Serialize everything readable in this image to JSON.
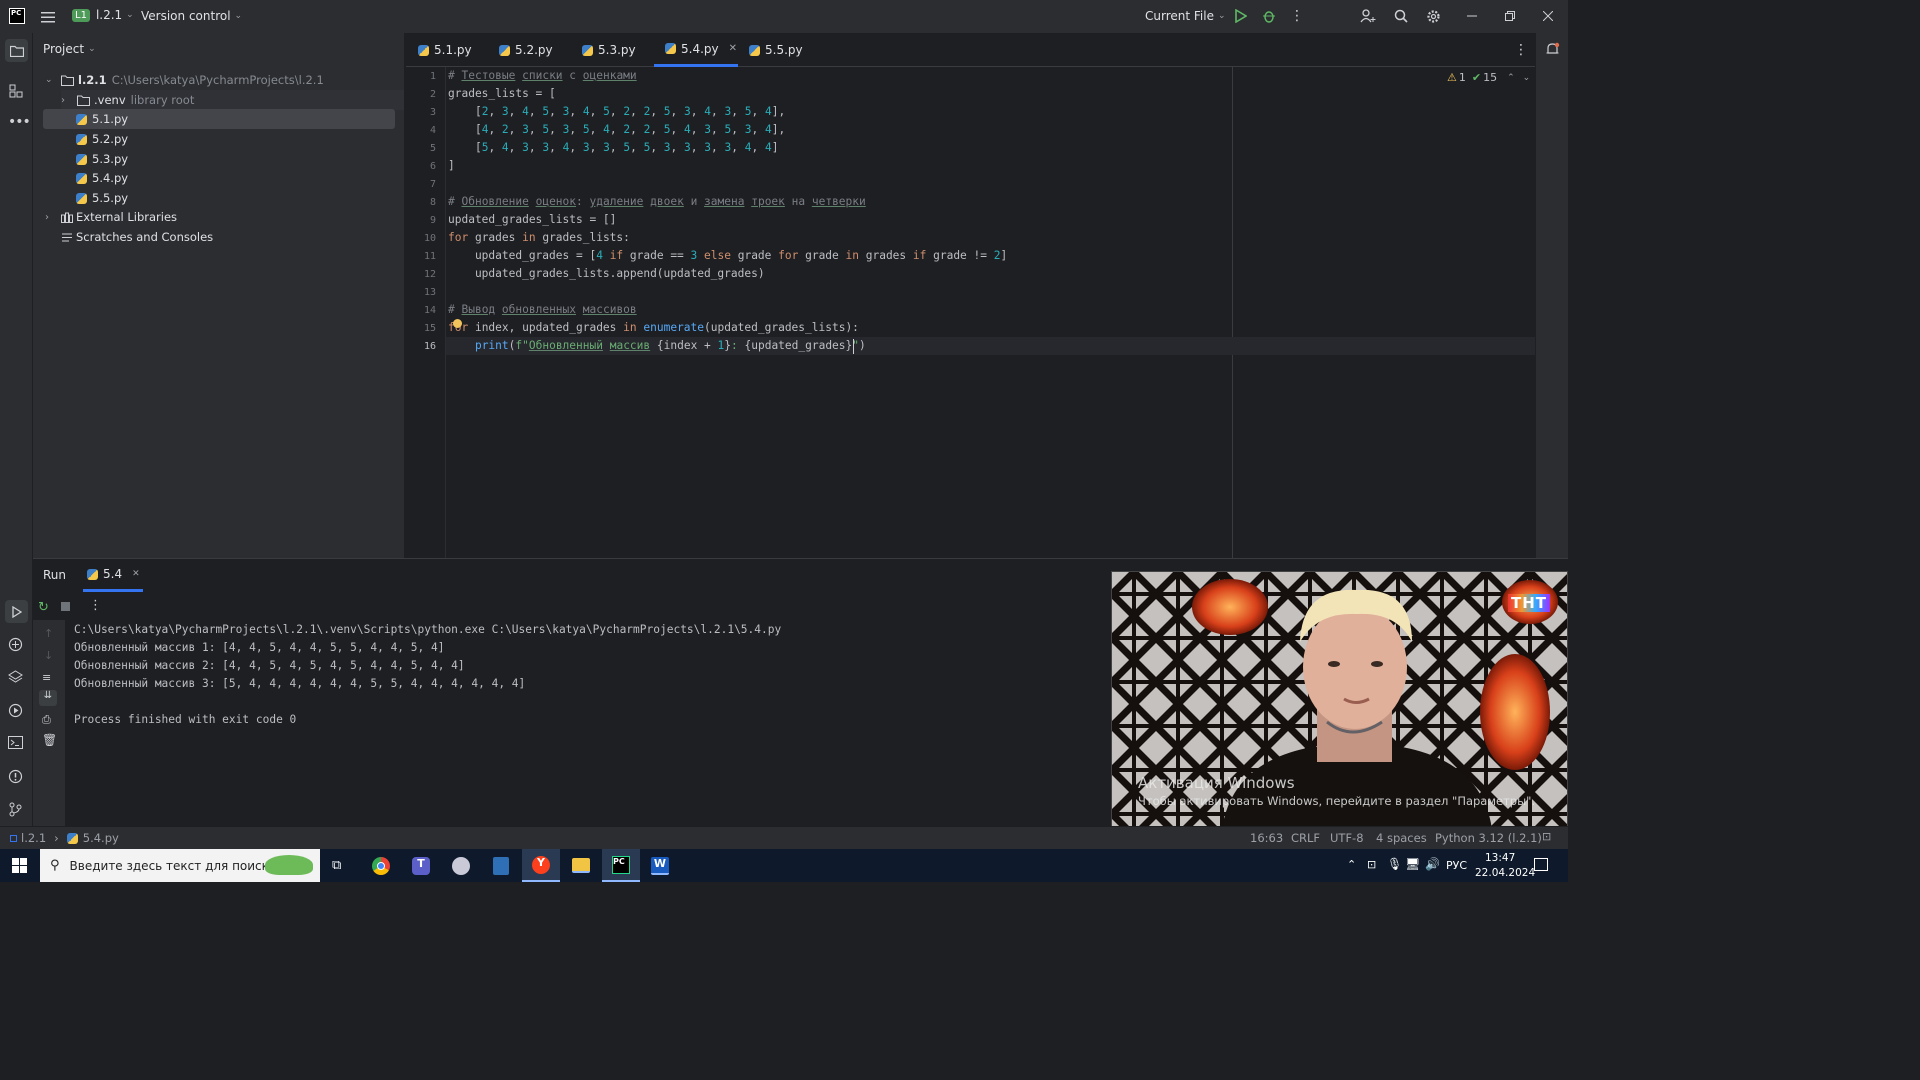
{
  "titlebar": {
    "project_badge": "L1",
    "project_name": "l.2.1",
    "vcs": "Version control",
    "run_config": "Current File"
  },
  "project_panel": {
    "title": "Project",
    "root_name": "l.2.1",
    "root_path": "C:\\Users\\katya\\PycharmProjects\\l.2.1",
    "venv_name": ".venv",
    "venv_note": "library root",
    "files": [
      "5.1.py",
      "5.2.py",
      "5.3.py",
      "5.4.py",
      "5.5.py"
    ],
    "external_libraries": "External Libraries",
    "scratches": "Scratches and Consoles"
  },
  "tabs": [
    "5.1.py",
    "5.2.py",
    "5.3.py",
    "5.4.py",
    "5.5.py"
  ],
  "active_tab": "5.4.py",
  "inspections": {
    "warnings": "1",
    "ok": "15"
  },
  "code_lines": [
    "# Тестовые списки с оценками",
    "grades_lists = [",
    "    [2, 3, 4, 5, 3, 4, 5, 2, 2, 5, 3, 4, 3, 5, 4],",
    "    [4, 2, 3, 5, 3, 5, 4, 2, 2, 5, 4, 3, 5, 3, 4],",
    "    [5, 4, 3, 3, 4, 3, 3, 5, 5, 3, 3, 3, 3, 4, 4]",
    "]",
    "",
    "# Обновление оценок: удаление двоек и замена троек на четверки",
    "updated_grades_lists = []",
    "for grades in grades_lists:",
    "    updated_grades = [4 if grade == 3 else grade for grade in grades if grade != 2]",
    "    updated_grades_lists.append(updated_grades)",
    "",
    "# Вывод обновленных массивов",
    "for index, updated_grades in enumerate(updated_grades_lists):",
    "    print(f\"Обновленный массив {index + 1}: {updated_grades}\")"
  ],
  "line_numbers": [
    "1",
    "2",
    "3",
    "4",
    "5",
    "6",
    "7",
    "8",
    "9",
    "10",
    "11",
    "12",
    "13",
    "14",
    "15",
    "16"
  ],
  "run_panel": {
    "title": "Run",
    "tab": "5.4",
    "output": [
      "C:\\Users\\katya\\PycharmProjects\\l.2.1\\.venv\\Scripts\\python.exe C:\\Users\\katya\\PycharmProjects\\l.2.1\\5.4.py",
      "Обновленный массив 1: [4, 4, 5, 4, 4, 5, 5, 4, 4, 5, 4]",
      "Обновленный массив 2: [4, 4, 5, 4, 5, 4, 5, 4, 4, 5, 4, 4]",
      "Обновленный массив 3: [5, 4, 4, 4, 4, 4, 4, 5, 5, 4, 4, 4, 4, 4, 4]",
      "",
      "Process finished with exit code 0"
    ]
  },
  "statusbar": {
    "crumb_project": "l.2.1",
    "crumb_file": "5.4.py",
    "position": "16:63",
    "line_sep": "CRLF",
    "encoding": "UTF-8",
    "indent": "4 spaces",
    "interpreter": "Python 3.12 (l.2.1)"
  },
  "taskbar": {
    "search_placeholder": "Введите здесь текст для поиска",
    "lang": "РУС",
    "time": "13:47",
    "date": "22.04.2024"
  },
  "video_overlay": {
    "activation_title": "Активация Windows",
    "activation_text": "Чтобы активировать Windows, перейдите в раздел \"Параметры\".",
    "channel_logo": "ТНТ"
  }
}
